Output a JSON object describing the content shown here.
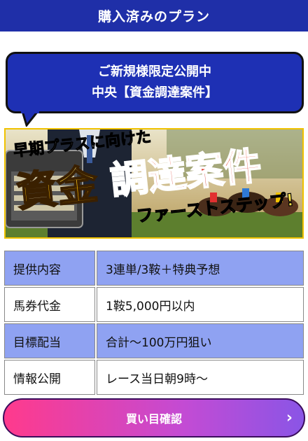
{
  "header": {
    "title": "購入済みのプラン"
  },
  "bubble": {
    "line1": "ご新規様限定公開中",
    "line2": "中央【資金調達案件】"
  },
  "banner": {
    "tagline": "早期プラスに向けた",
    "headline_a": "資金",
    "headline_b": "調達案件",
    "subline": "ファーストステップ!"
  },
  "info": [
    {
      "label": "提供内容",
      "value": "3連単/3鞍＋特典予想",
      "style": "blue"
    },
    {
      "label": "馬券代金",
      "value": "1鞍5,000円以内",
      "style": "white"
    },
    {
      "label": "目標配当",
      "value": "合計～100万円狙い",
      "style": "blue"
    },
    {
      "label": "情報公開",
      "value": "レース当日朝9時～",
      "style": "white"
    }
  ],
  "cta": {
    "label": "買い目確認",
    "arrow_icon": "chevron-right-icon"
  },
  "colors": {
    "header": "#1f2fa8",
    "bubble": "#1e30b4",
    "row_blue": "#8fa2f2",
    "cta_start": "#ff3a8c",
    "cta_end": "#8a55e6"
  }
}
